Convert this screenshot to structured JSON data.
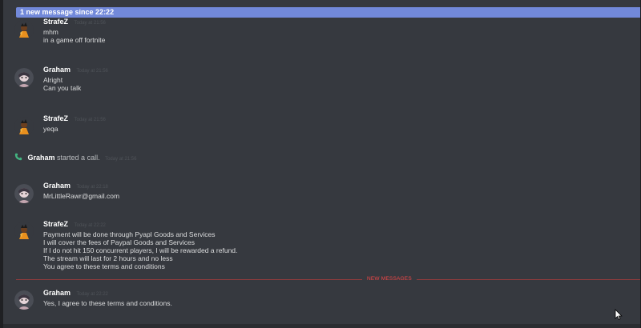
{
  "new_messages_bar": {
    "text": "1 new message since 22:22"
  },
  "messages": [
    {
      "author": "StrafeZ",
      "timestamp": "Today at 21:56",
      "lines": [
        "mhm",
        "in a game off fortnite"
      ]
    },
    {
      "author": "Graham",
      "timestamp": "Today at 21:56",
      "lines": [
        "Alright",
        "Can you talk"
      ]
    },
    {
      "author": "StrafeZ",
      "timestamp": "Today at 21:56",
      "lines": [
        "yeqa"
      ]
    },
    {
      "author": "Graham",
      "timestamp": "Today at 22:18",
      "lines": [
        "MrLittleRawr@gmail.com"
      ]
    },
    {
      "author": "StrafeZ",
      "timestamp": "Today at 22:22",
      "lines": [
        "Payment will be done through Pyapl Goods and Services",
        "I will cover the fees of Paypal Goods and Services",
        "If I do not hit 150 concurrent players, I will be rewarded a refund.",
        "The stream will last for 2 hours and no less",
        "You agree to these terms and conditions"
      ]
    },
    {
      "author": "Graham",
      "timestamp": "Today at 22:22",
      "lines": [
        "Yes, I agree to these terms and conditions."
      ]
    }
  ],
  "system_message": {
    "author": "Graham",
    "text": "started a call.",
    "timestamp": "Today at 21:56"
  },
  "divider": {
    "label": "NEW MESSAGES"
  },
  "icons": {
    "call": "phone-icon",
    "cursor": "mouse-cursor-icon"
  },
  "colors": {
    "background": "#36393f",
    "accent": "#7289da",
    "new_messages": "#f04747",
    "call": "#43b581"
  }
}
